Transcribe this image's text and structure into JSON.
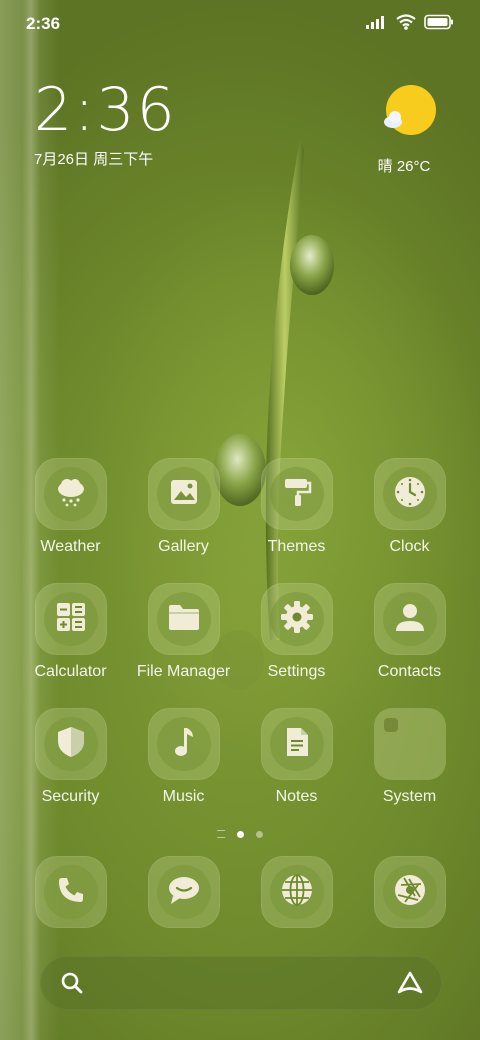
{
  "status_bar": {
    "time": "2:36",
    "icons": [
      "signal-icon",
      "wifi-icon",
      "battery-icon"
    ]
  },
  "clock_widget": {
    "time": "2:36",
    "date": "7月26日 周三下午"
  },
  "weather_widget": {
    "condition_icon": "sun-cloud-icon",
    "text": "晴 26°C"
  },
  "apps": [
    {
      "label": "Weather",
      "icon": "weather-cloud-icon"
    },
    {
      "label": "Gallery",
      "icon": "gallery-image-icon"
    },
    {
      "label": "Themes",
      "icon": "paint-roller-icon"
    },
    {
      "label": "Clock",
      "icon": "clock-icon"
    },
    {
      "label": "Calculator",
      "icon": "calculator-icon"
    },
    {
      "label": "File Manager",
      "icon": "folder-icon"
    },
    {
      "label": "Settings",
      "icon": "gear-icon"
    },
    {
      "label": "Contacts",
      "icon": "person-icon"
    },
    {
      "label": "Security",
      "icon": "shield-icon"
    },
    {
      "label": "Music",
      "icon": "music-note-icon"
    },
    {
      "label": "Notes",
      "icon": "note-document-icon"
    },
    {
      "label": "System",
      "icon": "folder-group-icon"
    }
  ],
  "dock": [
    {
      "icon": "phone-icon"
    },
    {
      "icon": "message-icon"
    },
    {
      "icon": "browser-globe-icon"
    },
    {
      "icon": "camera-shutter-icon"
    }
  ],
  "pager": {
    "pages": 2,
    "active": 0
  },
  "search": {
    "icons": [
      "search-icon",
      "assistant-icon"
    ]
  },
  "colors": {
    "accent_sun": "#f7cc1c",
    "icon_fg": "#f1ecd8"
  }
}
